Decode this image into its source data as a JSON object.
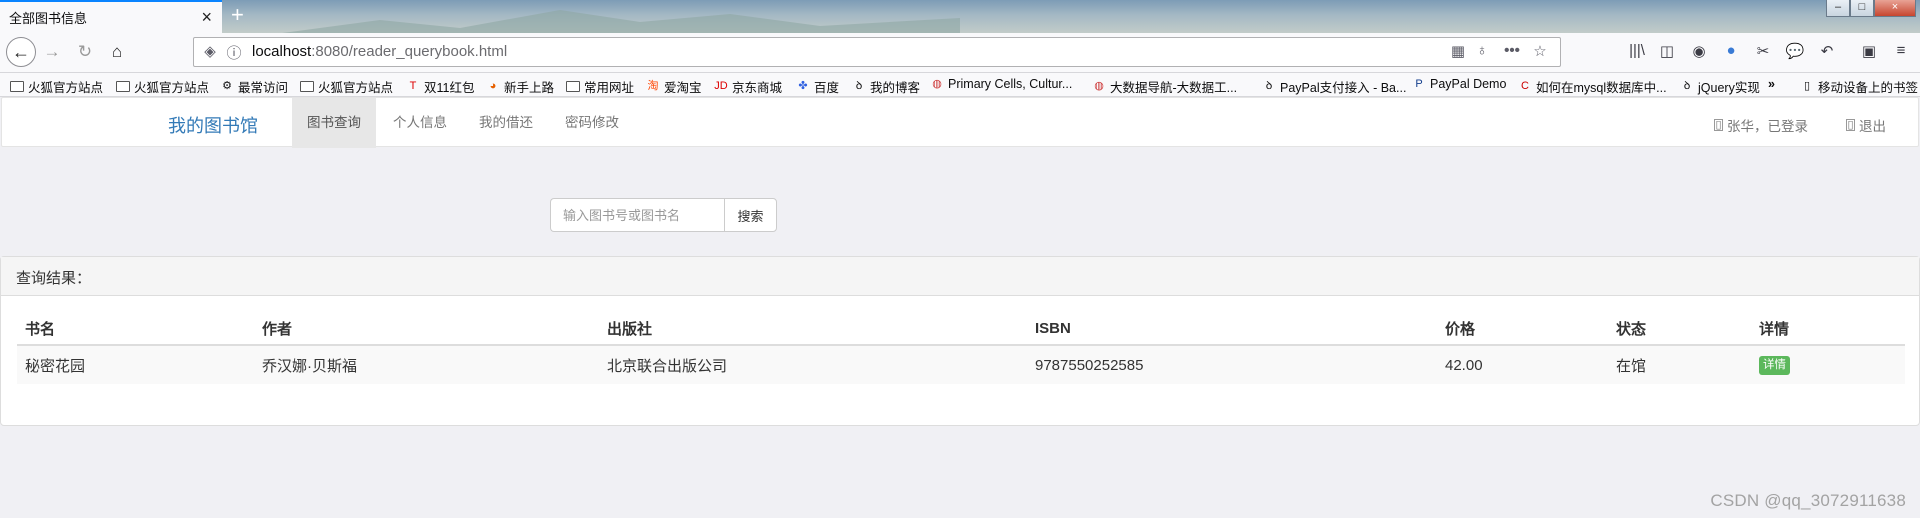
{
  "browser": {
    "tab_title": "全部图书信息",
    "url_host": "localhost",
    "url_rest": ":8080/reader_querybook.html",
    "bookmarks": [
      {
        "label": "火狐官方站点",
        "icon": "folder-icon"
      },
      {
        "label": "火狐官方站点",
        "icon": "folder-icon"
      },
      {
        "label": "最常访问",
        "icon": "gear-icon"
      },
      {
        "label": "火狐官方站点",
        "icon": "folder-icon"
      },
      {
        "label": "双11红包",
        "icon": "tmall-icon"
      },
      {
        "label": "新手上路",
        "icon": "firefox-icon"
      },
      {
        "label": "常用网址",
        "icon": "folder-icon"
      },
      {
        "label": "爱淘宝",
        "icon": "taobao-icon"
      },
      {
        "label": "京东商城",
        "icon": "jd-icon"
      },
      {
        "label": "百度",
        "icon": "baidu-icon"
      },
      {
        "label": "我的博客",
        "icon": "blog-icon"
      },
      {
        "label": "Primary Cells, Cultur...",
        "icon": "site-icon"
      },
      {
        "label": "大数据导航-大数据工...",
        "icon": "site-icon"
      },
      {
        "label": "PayPal支付接入 - Ba...",
        "icon": "blog-icon"
      },
      {
        "label": "PayPal Demo",
        "icon": "paypal-icon"
      },
      {
        "label": "如何在mysql数据库中...",
        "icon": "csdn-icon"
      },
      {
        "label": "jQuery实现",
        "icon": "blog-icon"
      },
      {
        "label": "移动设备上的书签",
        "icon": "mobile-icon"
      }
    ]
  },
  "site": {
    "brand": "我的图书馆",
    "nav": [
      "图书查询",
      "个人信息",
      "我的借还",
      "密码修改"
    ],
    "user_status": "张华，已登录",
    "logout": "退出"
  },
  "search": {
    "placeholder": "输入图书号或图书名",
    "button": "搜索"
  },
  "results": {
    "heading": "查询结果：",
    "columns": [
      "书名",
      "作者",
      "出版社",
      "ISBN",
      "价格",
      "状态",
      "详情"
    ],
    "rows": [
      {
        "title": "秘密花园",
        "author": "乔汉娜·贝斯福",
        "publisher": "北京联合出版公司",
        "isbn": "9787550252585",
        "price": "42.00",
        "status": "在馆",
        "detail": "详情"
      }
    ]
  },
  "watermark": "CSDN @qq_3072911638",
  "colors": {
    "brand": "#337ab7",
    "detail_button": "#5cb85c",
    "tab_accent": "#0a84ff"
  }
}
